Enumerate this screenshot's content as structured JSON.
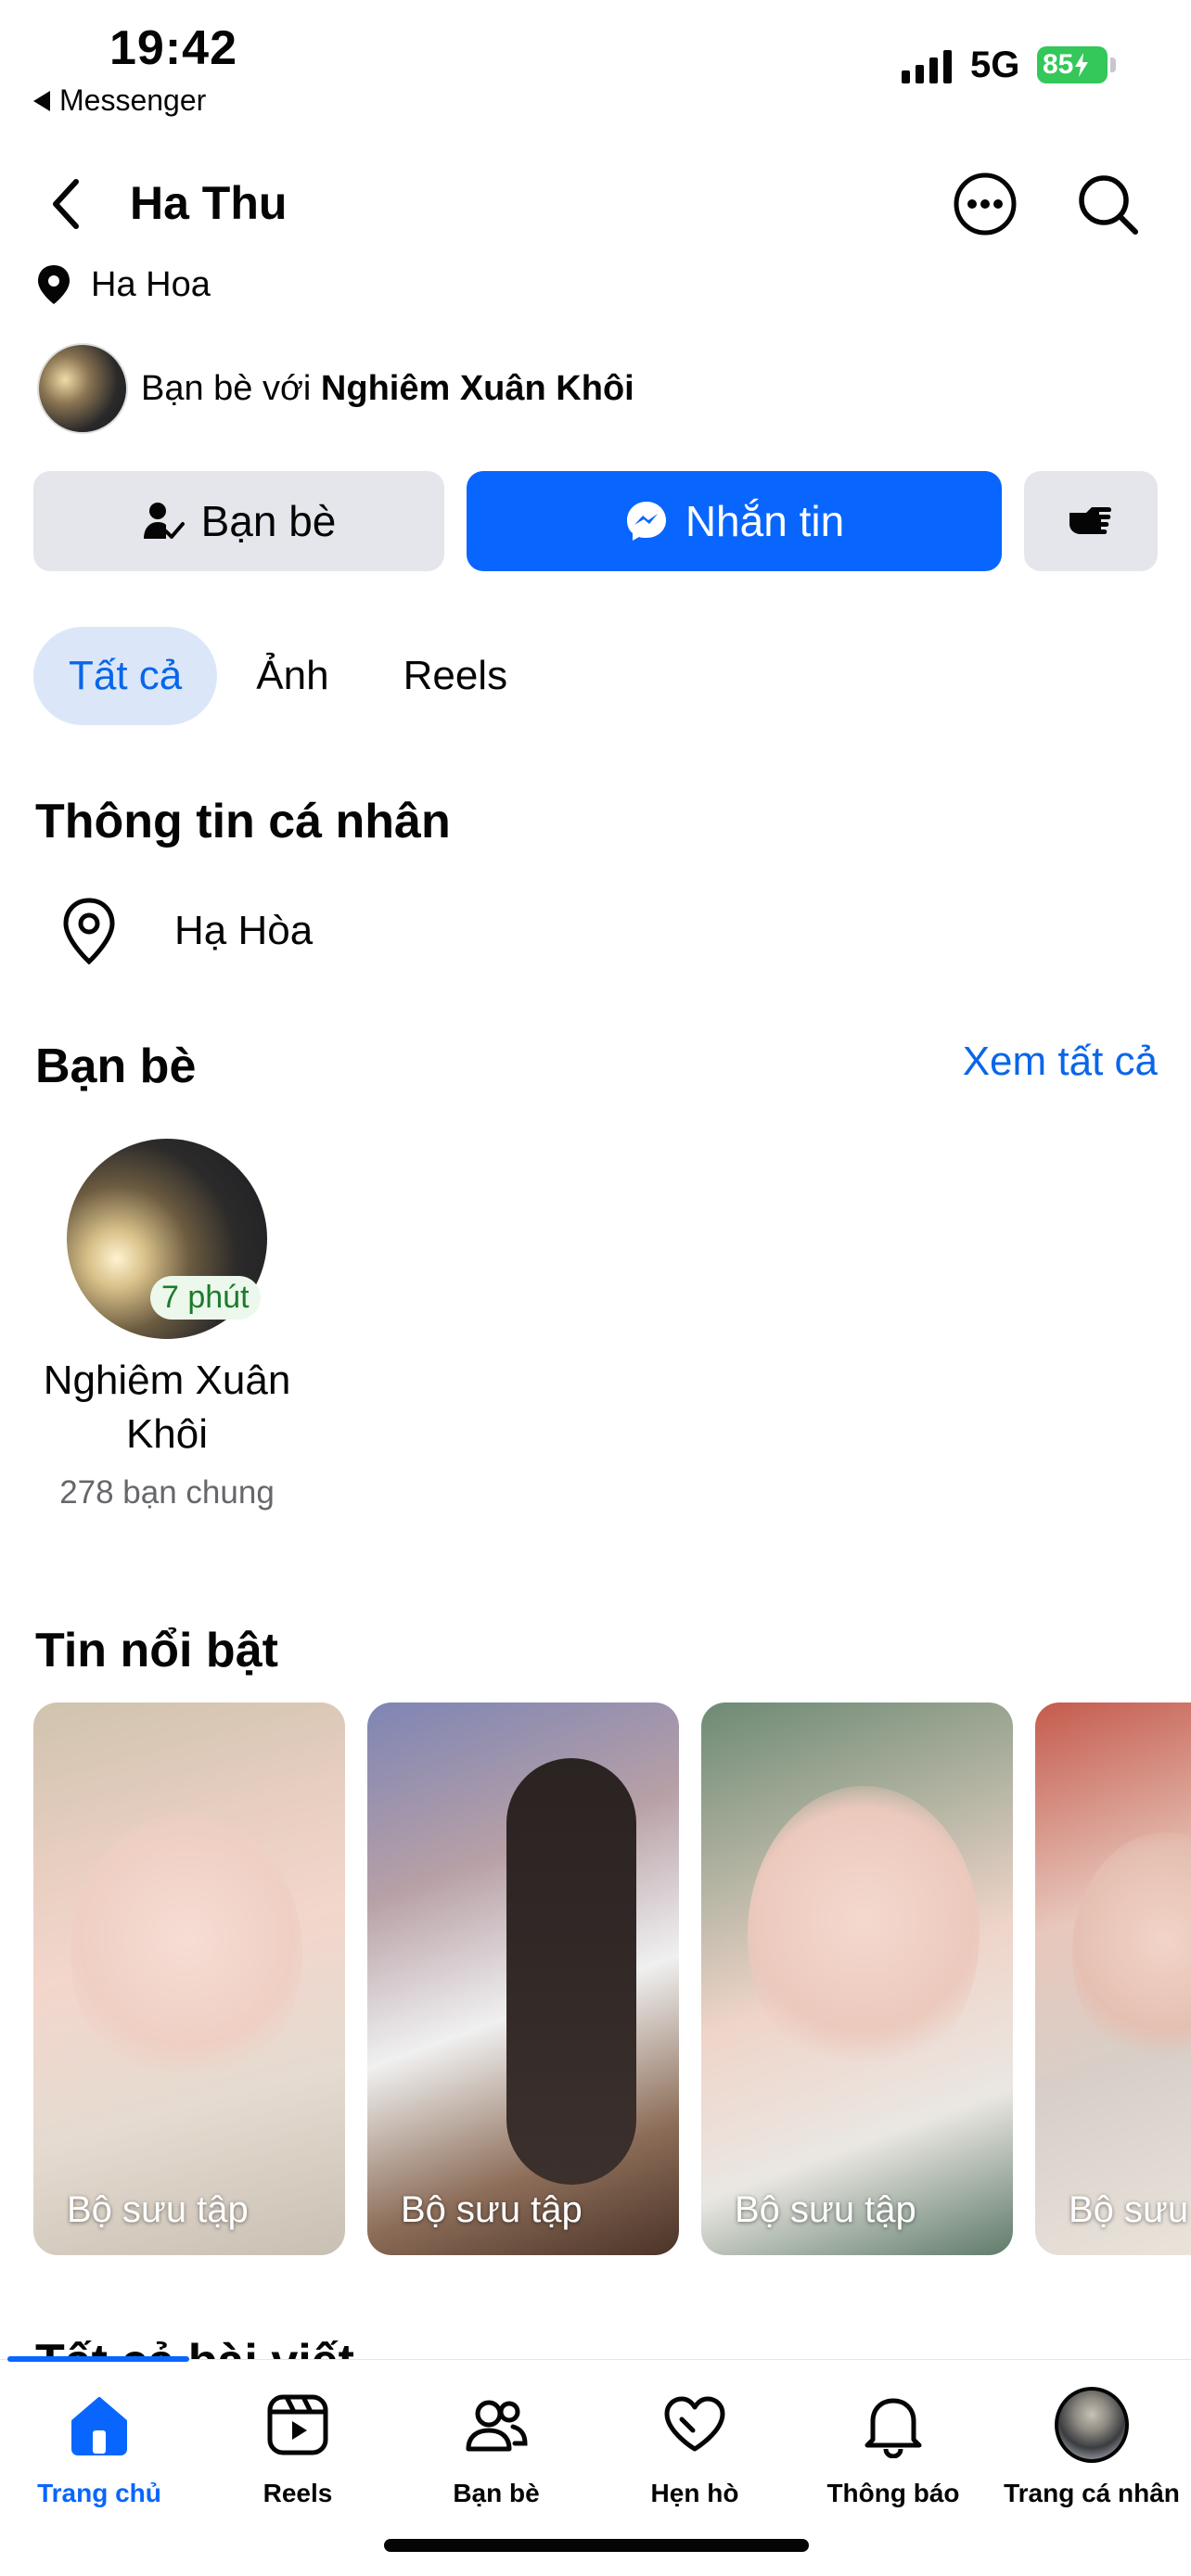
{
  "status_bar": {
    "time": "19:42",
    "back_app": "Messenger",
    "network": "5G",
    "battery": "85"
  },
  "header": {
    "title": "Ha Thu"
  },
  "intro": {
    "location": "Ha Hoa",
    "friends_with_prefix": "Bạn bè với",
    "friends_with_name": "Nghiêm Xuân Khôi"
  },
  "actions": {
    "friends_label": "Bạn bè",
    "message_label": "Nhắn tin"
  },
  "tabs": [
    {
      "label": "Tất cả",
      "active": true
    },
    {
      "label": "Ảnh",
      "active": false
    },
    {
      "label": "Reels",
      "active": false
    }
  ],
  "personal_info": {
    "title": "Thông tin cá nhân",
    "location": "Hạ Hòa"
  },
  "friends": {
    "title": "Bạn bè",
    "see_all": "Xem tất cả",
    "items": [
      {
        "name": "Nghiêm Xuân Khôi",
        "mutual": "278 bạn chung",
        "active": "7 phút"
      }
    ]
  },
  "highlights": {
    "title": "Tin nổi bật",
    "items": [
      {
        "label": "Bộ sưu tập"
      },
      {
        "label": "Bộ sưu tập"
      },
      {
        "label": "Bộ sưu tập"
      },
      {
        "label": "Bộ sưu tập"
      }
    ]
  },
  "posts": {
    "title": "Tất cả bài viết"
  },
  "bottom_nav": [
    {
      "label": "Trang chủ",
      "icon": "home-icon",
      "active": true
    },
    {
      "label": "Reels",
      "icon": "reels-icon",
      "active": false
    },
    {
      "label": "Bạn bè",
      "icon": "friends-icon",
      "active": false
    },
    {
      "label": "Hẹn hò",
      "icon": "heart-icon",
      "active": false
    },
    {
      "label": "Thông báo",
      "icon": "bell-icon",
      "active": false
    },
    {
      "label": "Trang cá nhân",
      "icon": "profile-avatar",
      "active": false
    }
  ],
  "colors": {
    "accent": "#0866ff",
    "tab_active_bg": "#dbe7f9",
    "button_secondary": "#e4e6eb",
    "battery": "#34c759"
  }
}
